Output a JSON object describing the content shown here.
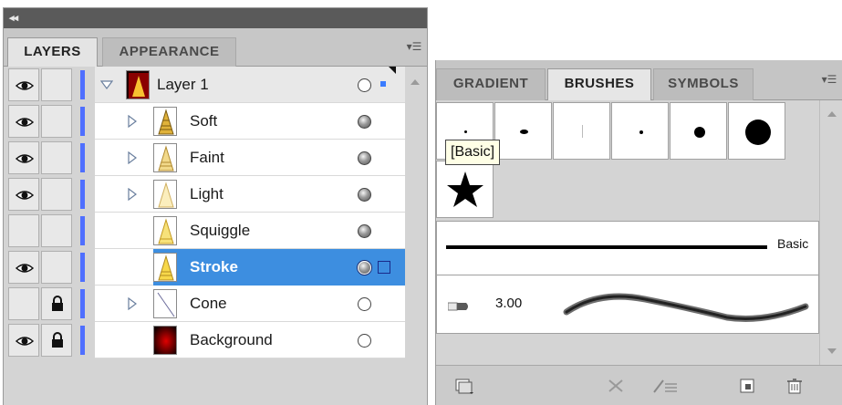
{
  "layers_panel": {
    "collapse_glyph": "◂◂",
    "tabs": [
      {
        "label": "LAYERS",
        "active": true
      },
      {
        "label": "APPEARANCE",
        "active": false
      }
    ],
    "menu_icon": "panel-menu-icon",
    "layers": [
      {
        "name": "Layer 1",
        "visible": true,
        "locked": false,
        "expanded": true,
        "selected": false,
        "target": "hollow"
      },
      {
        "name": "Soft",
        "visible": true,
        "locked": false,
        "expanded": false,
        "selected": false,
        "target": "filled"
      },
      {
        "name": "Faint",
        "visible": true,
        "locked": false,
        "expanded": false,
        "selected": false,
        "target": "filled"
      },
      {
        "name": "Light",
        "visible": true,
        "locked": false,
        "expanded": false,
        "selected": false,
        "target": "filled"
      },
      {
        "name": "Squiggle",
        "visible": true,
        "locked": false,
        "expanded": null,
        "selected": false,
        "target": "filled"
      },
      {
        "name": "Stroke",
        "visible": true,
        "locked": false,
        "expanded": null,
        "selected": true,
        "target": "filled"
      },
      {
        "name": "Cone",
        "visible": false,
        "locked": true,
        "expanded": false,
        "selected": false,
        "target": "hollow"
      },
      {
        "name": "Background",
        "visible": true,
        "locked": true,
        "expanded": null,
        "selected": false,
        "target": "hollow"
      }
    ],
    "layer_color": "#4f6fff",
    "selection_color": "#3d8ee0"
  },
  "brushes_panel": {
    "tabs": [
      {
        "label": "GRADIENT",
        "active": false
      },
      {
        "label": "BRUSHES",
        "active": true
      },
      {
        "label": "SYMBOLS",
        "active": false
      }
    ],
    "basic_label": "Basic",
    "tooltip": "[Basic]",
    "stroke_size": "3.00",
    "toolbar_icons": [
      "brush-libraries-icon",
      "remove-stroke-icon",
      "brush-options-icon",
      "new-brush-icon",
      "delete-brush-icon"
    ]
  }
}
